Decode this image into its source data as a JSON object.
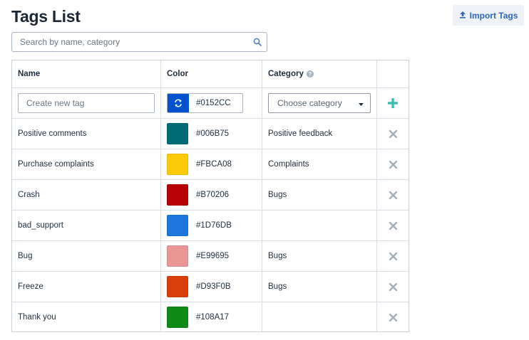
{
  "page": {
    "title": "Tags List"
  },
  "import_button": {
    "label": "Import Tags"
  },
  "search": {
    "placeholder": "Search by name, category"
  },
  "table": {
    "headers": {
      "name": "Name",
      "color": "Color",
      "category": "Category"
    },
    "new_tag": {
      "name_placeholder": "Create new tag",
      "color": "#0152CC",
      "category_placeholder": "Choose category"
    },
    "rows": [
      {
        "name": "Positive comments",
        "color": "#006B75",
        "category": "Positive feedback"
      },
      {
        "name": "Purchase complaints",
        "color": "#FBCA08",
        "category": "Complaints"
      },
      {
        "name": "Crash",
        "color": "#B70206",
        "category": "Bugs"
      },
      {
        "name": "bad_support",
        "color": "#1D76DB",
        "category": ""
      },
      {
        "name": "Bug",
        "color": "#E99695",
        "category": "Bugs"
      },
      {
        "name": "Freeze",
        "color": "#D93F0B",
        "category": "Bugs"
      },
      {
        "name": "Thank you",
        "color": "#108A17",
        "category": ""
      }
    ]
  },
  "icons": {
    "upload": "upload-icon",
    "search": "search-icon",
    "help": "question-circle-icon",
    "refresh": "refresh-icon",
    "caret": "caret-down-icon",
    "add": "plus-icon",
    "delete": "close-icon"
  },
  "colors": {
    "accent": "#2c67b8",
    "add": "#3bbdb0",
    "delete": "#a6b0ba"
  }
}
